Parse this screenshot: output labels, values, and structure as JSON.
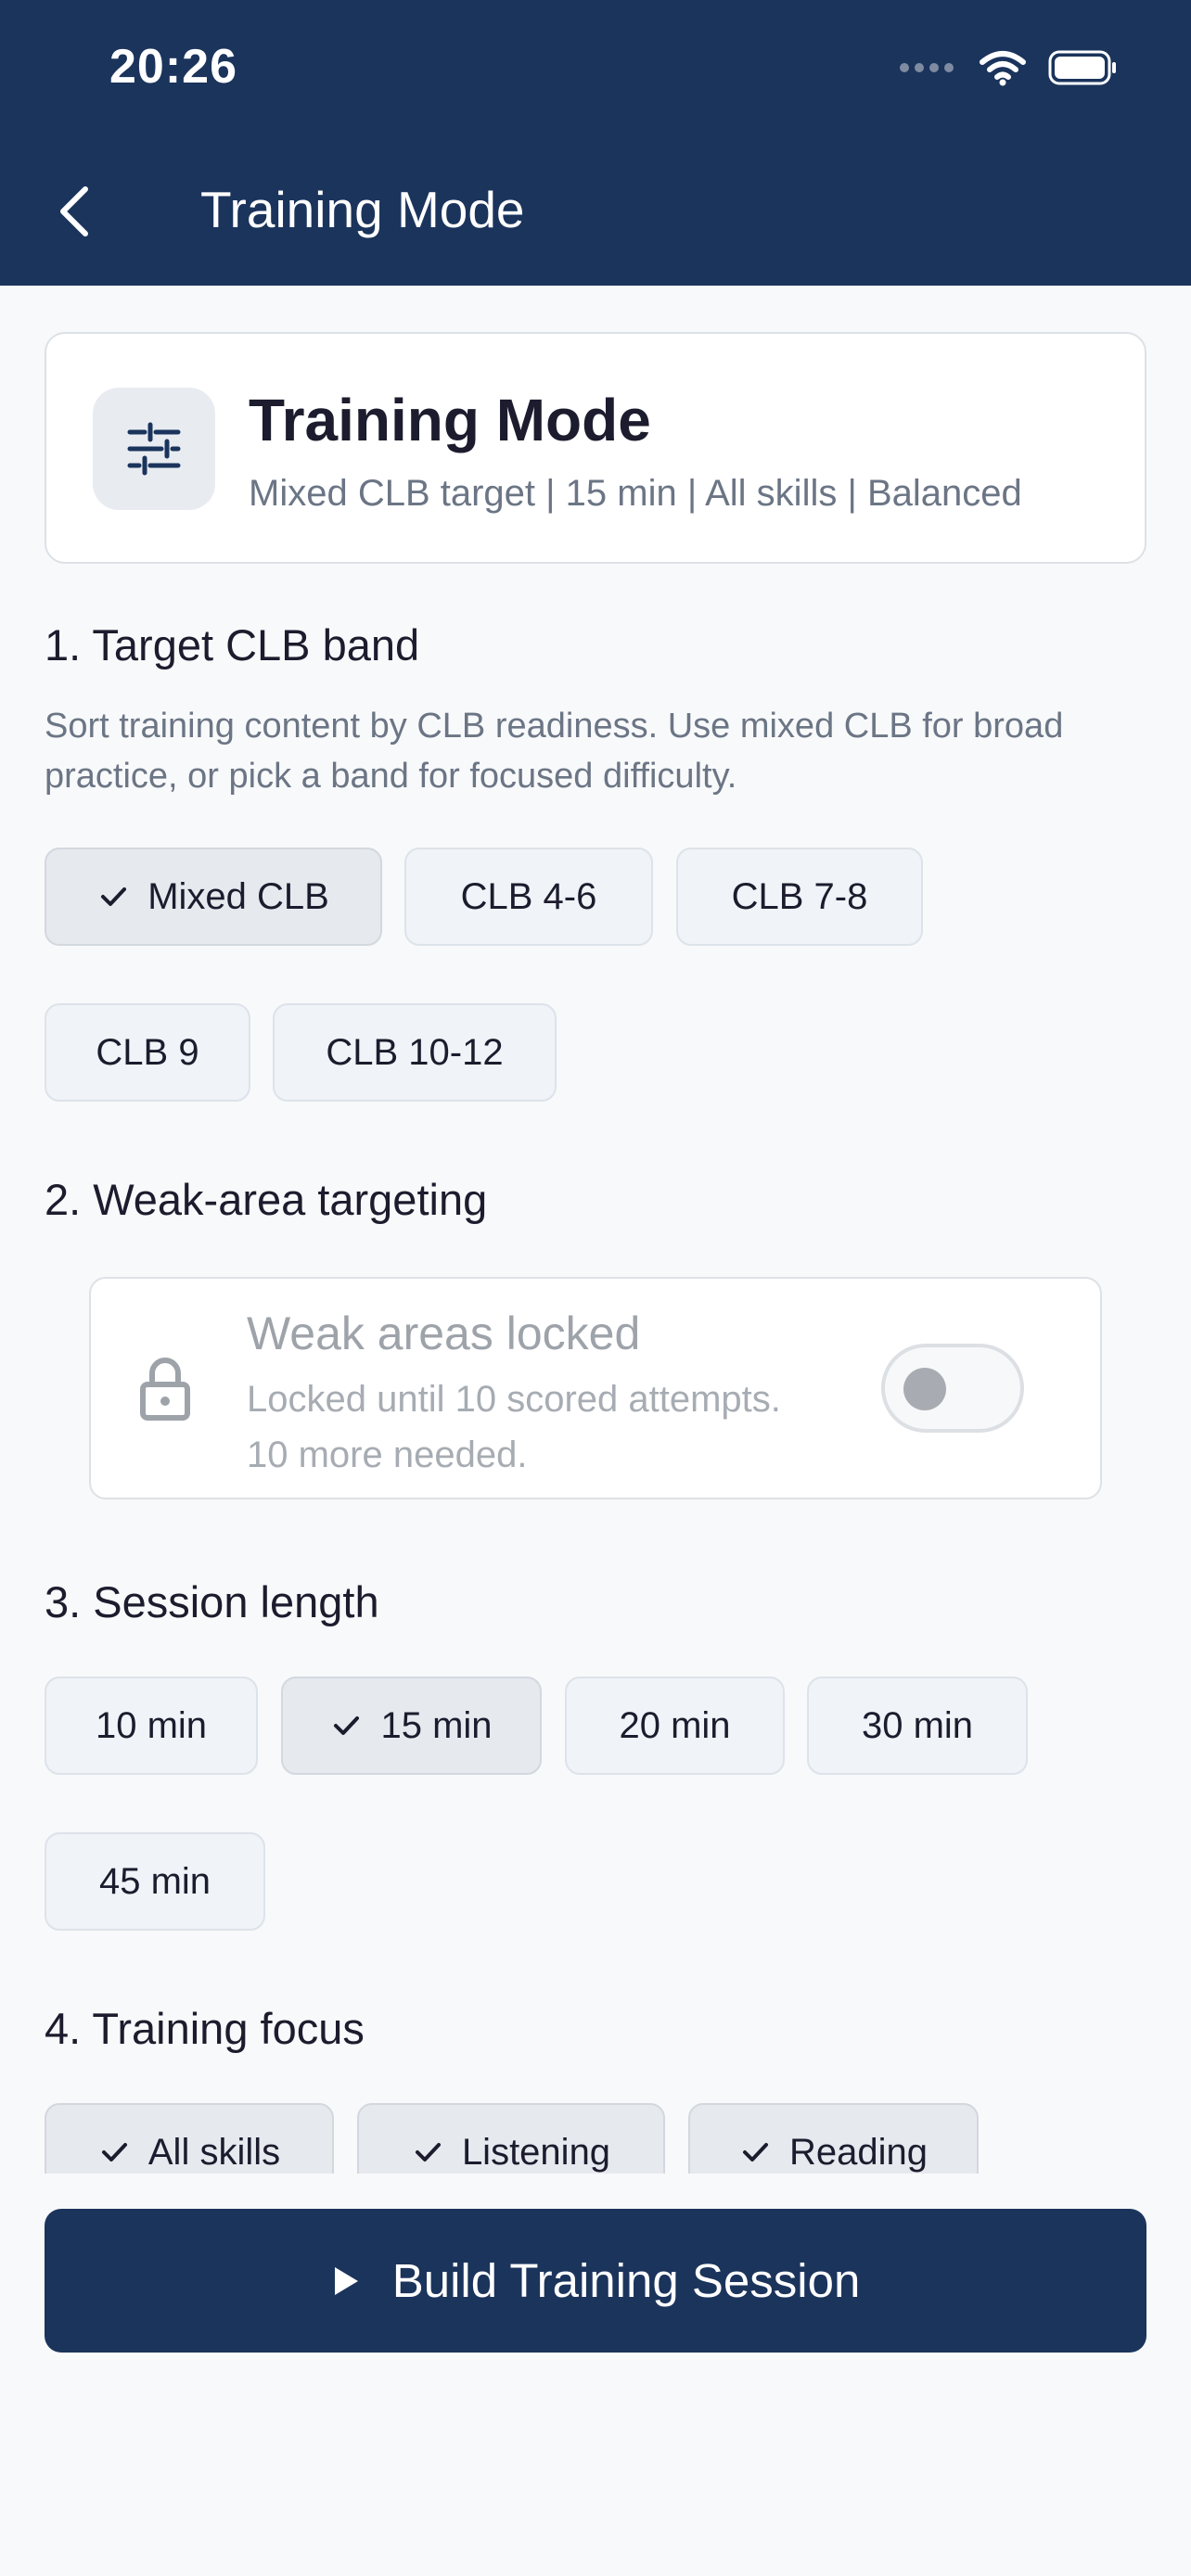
{
  "status_bar": {
    "time": "20:26",
    "icons": [
      "signal-icon",
      "wifi-icon",
      "battery-icon"
    ]
  },
  "header": {
    "title": "Training Mode",
    "back_icon": "chevron-left-icon"
  },
  "summary": {
    "icon": "sliders-icon",
    "title": "Training Mode",
    "subtitle": "Mixed CLB target | 15 min | All skills | Balanced"
  },
  "sections": {
    "clb": {
      "heading": "1. Target CLB band",
      "description": "Sort training content by CLB readiness. Use mixed CLB for broad practice, or pick a band for focused difficulty.",
      "options": [
        {
          "label": "Mixed CLB",
          "selected": true
        },
        {
          "label": "CLB 4-6",
          "selected": false
        },
        {
          "label": "CLB 7-8",
          "selected": false
        },
        {
          "label": "CLB 9",
          "selected": false
        },
        {
          "label": "CLB 10-12",
          "selected": false
        }
      ]
    },
    "weak": {
      "heading": "2. Weak-area targeting",
      "lock_title": "Weak areas locked",
      "lock_subtitle": "Locked until 10 scored attempts. 10 more needed.",
      "toggle_on": false,
      "lock_icon": "lock-icon"
    },
    "length": {
      "heading": "3. Session length",
      "options": [
        {
          "label": "10 min",
          "selected": false
        },
        {
          "label": "15 min",
          "selected": true
        },
        {
          "label": "20 min",
          "selected": false
        },
        {
          "label": "30 min",
          "selected": false
        },
        {
          "label": "45 min",
          "selected": false
        }
      ]
    },
    "focus": {
      "heading": "4. Training focus",
      "options": [
        {
          "label": "All skills",
          "selected": true
        },
        {
          "label": "Listening",
          "selected": true
        },
        {
          "label": "Reading",
          "selected": true
        }
      ]
    }
  },
  "cta": {
    "label": "Build Training Session",
    "icon": "play-icon"
  },
  "colors": {
    "primary": "#1b345c",
    "background": "#f8f9fa",
    "muted_text": "#6b7585"
  }
}
